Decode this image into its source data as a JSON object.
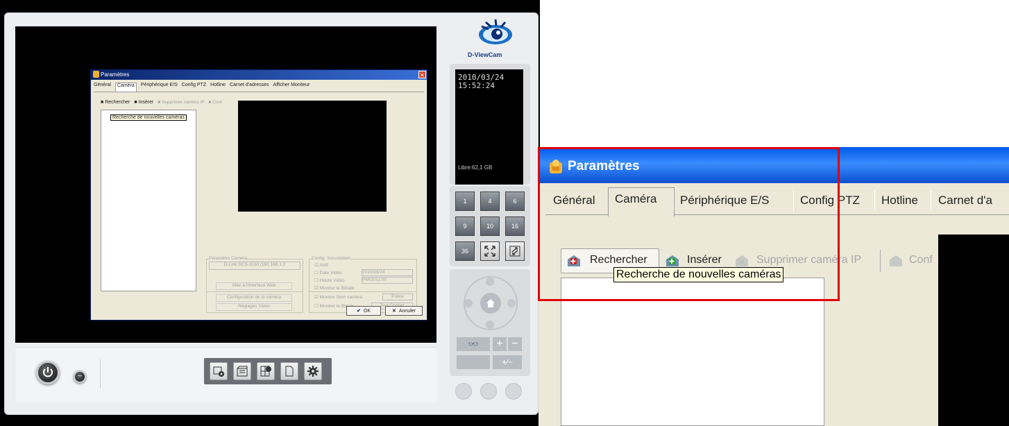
{
  "logo": {
    "brand": "D-ViewCam"
  },
  "info_screen": {
    "date": "2010/03/24",
    "time": "15:52:24",
    "free_space": "Libre:62,1 GB"
  },
  "layout_buttons": [
    "1",
    "4",
    "6",
    "9",
    "10",
    "16",
    "36"
  ],
  "small_dialog": {
    "title": "Paramètres",
    "tabs": [
      "Général",
      "Caméra",
      "Périphérique E/S",
      "Config PTZ",
      "Hotline",
      "Carnet d'adresses",
      "Afficher Moniteur"
    ],
    "toolbar": {
      "search": "Rechercher",
      "insert": "Insérer",
      "delete": "Supprimer caméra IP",
      "config": "Conf"
    },
    "tooltip": "Recherche de nouvelles caméras",
    "camera_params": {
      "group_title": "Paramètre Caméra",
      "device": "D-Link DCS-1130 (192.168.1.2",
      "btn_web": "Aller à l'interface Web",
      "btn_config": "Configuration de la caméra",
      "btn_video": "Réglages Vidéo"
    },
    "incrustation": {
      "group_title": "Config. Incrustation",
      "active": "Actif",
      "show_date": "Date Vidéo",
      "date_value": "2010/03/24",
      "show_time": "Heure Vidéo",
      "time_value": "PM03:51:00",
      "show_bitrate": "Montrer le Bitrate",
      "show_camname": "Montrer Nom caméra",
      "btn_font": "Police",
      "show_bitrate2": "Montrer le Bitrate",
      "btn_check_all": "Tout Cocher"
    },
    "ok": "OK",
    "cancel": "Annuler"
  },
  "zoom_dialog": {
    "title": "Paramètres",
    "tabs": [
      "Général",
      "Caméra",
      "Périphérique E/S",
      "Config PTZ",
      "Hotline",
      "Carnet d'a"
    ],
    "toolbar": {
      "search": "Rechercher",
      "insert": "Insérer",
      "delete": "Supprimer caméra IP",
      "config": "Conf"
    },
    "tooltip": "Recherche de nouvelles caméras"
  },
  "colors": {
    "highlight_box": "#e00000",
    "titlebar": "#0058e6",
    "dialog_bg": "#ece9d8"
  }
}
